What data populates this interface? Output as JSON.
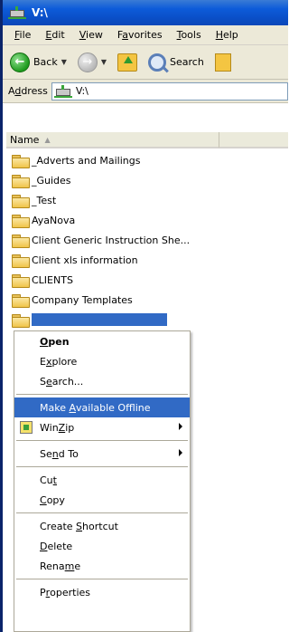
{
  "window": {
    "title": "V:\\"
  },
  "menubar": {
    "items": [
      {
        "pre": "",
        "ul": "F",
        "post": "ile"
      },
      {
        "pre": "",
        "ul": "E",
        "post": "dit"
      },
      {
        "pre": "",
        "ul": "V",
        "post": "iew"
      },
      {
        "pre": "F",
        "ul": "a",
        "post": "vorites"
      },
      {
        "pre": "",
        "ul": "T",
        "post": "ools"
      },
      {
        "pre": "",
        "ul": "H",
        "post": "elp"
      }
    ]
  },
  "toolbar": {
    "back_label": "Back",
    "search_label": "Search"
  },
  "address": {
    "label_pre": "A",
    "label_ul": "d",
    "label_post": "dress",
    "value": "V:\\"
  },
  "list": {
    "header_name": "Name",
    "folders": [
      "_Adverts and Mailings",
      "_Guides",
      "_Test",
      "AyaNova",
      "Client Generic Instruction She...",
      "Client xls information",
      "CLIENTS",
      "Company Templates"
    ]
  },
  "context_menu": {
    "items": [
      {
        "type": "item",
        "pre": "",
        "ul": "O",
        "post": "pen",
        "bold": true
      },
      {
        "type": "item",
        "pre": "E",
        "ul": "x",
        "post": "plore"
      },
      {
        "type": "item",
        "pre": "S",
        "ul": "e",
        "post": "arch..."
      },
      {
        "type": "sep"
      },
      {
        "type": "item",
        "pre": "Make ",
        "ul": "A",
        "post": "vailable Offline",
        "hover": true
      },
      {
        "type": "item",
        "pre": "Win",
        "ul": "Z",
        "post": "ip",
        "icon": "winzip-icon",
        "submenu": true
      },
      {
        "type": "sep"
      },
      {
        "type": "item",
        "pre": "Se",
        "ul": "n",
        "post": "d To",
        "submenu": true
      },
      {
        "type": "sep"
      },
      {
        "type": "item",
        "pre": "Cu",
        "ul": "t",
        "post": ""
      },
      {
        "type": "item",
        "pre": "",
        "ul": "C",
        "post": "opy"
      },
      {
        "type": "sep"
      },
      {
        "type": "item",
        "pre": "Create ",
        "ul": "S",
        "post": "hortcut"
      },
      {
        "type": "item",
        "pre": "",
        "ul": "D",
        "post": "elete"
      },
      {
        "type": "item",
        "pre": "Rena",
        "ul": "m",
        "post": "e"
      },
      {
        "type": "sep"
      },
      {
        "type": "item",
        "pre": "P",
        "ul": "r",
        "post": "operties"
      }
    ]
  },
  "colors": {
    "titlebar": "#0d5bd9",
    "selection": "#316ac5",
    "chrome": "#ece9d8"
  }
}
